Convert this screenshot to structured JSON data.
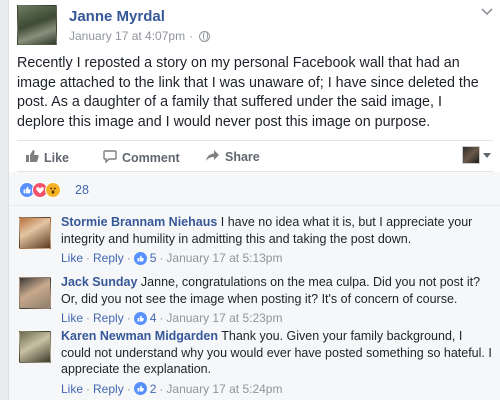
{
  "post": {
    "author": "Janne Myrdal",
    "timestamp": "January 17 at 4:07pm",
    "separator": "·",
    "text": "Recently I reposted a story on my personal Facebook wall that had an image attached to the link that I was unaware of; I have since deleted the post. As a daughter of a family that suffered under the said image, I deplore this image and I would never post this image on purpose."
  },
  "actions": {
    "like": "Like",
    "comment": "Comment",
    "share": "Share",
    "like_icon": "thumbs-up-icon",
    "comment_icon": "speech-bubble-icon",
    "share_icon": "share-arrow-icon"
  },
  "reactions": {
    "count": "28",
    "types": [
      "like",
      "love",
      "wow"
    ],
    "colors": {
      "like": "#5890ff",
      "love": "#f25268",
      "wow": "#f7b125"
    }
  },
  "comments": [
    {
      "name": "Stormie Brannam Niehaus",
      "text": "I have no idea what it is, but I appreciate your integrity and humility in admitting this and taking the post down.",
      "like": "Like",
      "reply": "Reply",
      "likes": "5",
      "time": "January 17 at 5:13pm"
    },
    {
      "name": "Jack Sunday",
      "text": "Janne, congratulations on the mea culpa. Did you not post it? Or, did you not see the image when posting it? It's of concern of course.",
      "like": "Like",
      "reply": "Reply",
      "likes": "4",
      "time": "January 17 at 5:23pm"
    },
    {
      "name": "Karen Newman Midgarden",
      "text": "Thank you. Given your family background, I could not understand why you would ever have posted something so hateful. I appreciate the explanation.",
      "like": "Like",
      "reply": "Reply",
      "likes": "2",
      "time": "January 17 at 5:24pm"
    }
  ],
  "colors": {
    "link": "#365899",
    "accent": "#4267b2",
    "muted": "#90949c",
    "background": "#e9ebee"
  }
}
